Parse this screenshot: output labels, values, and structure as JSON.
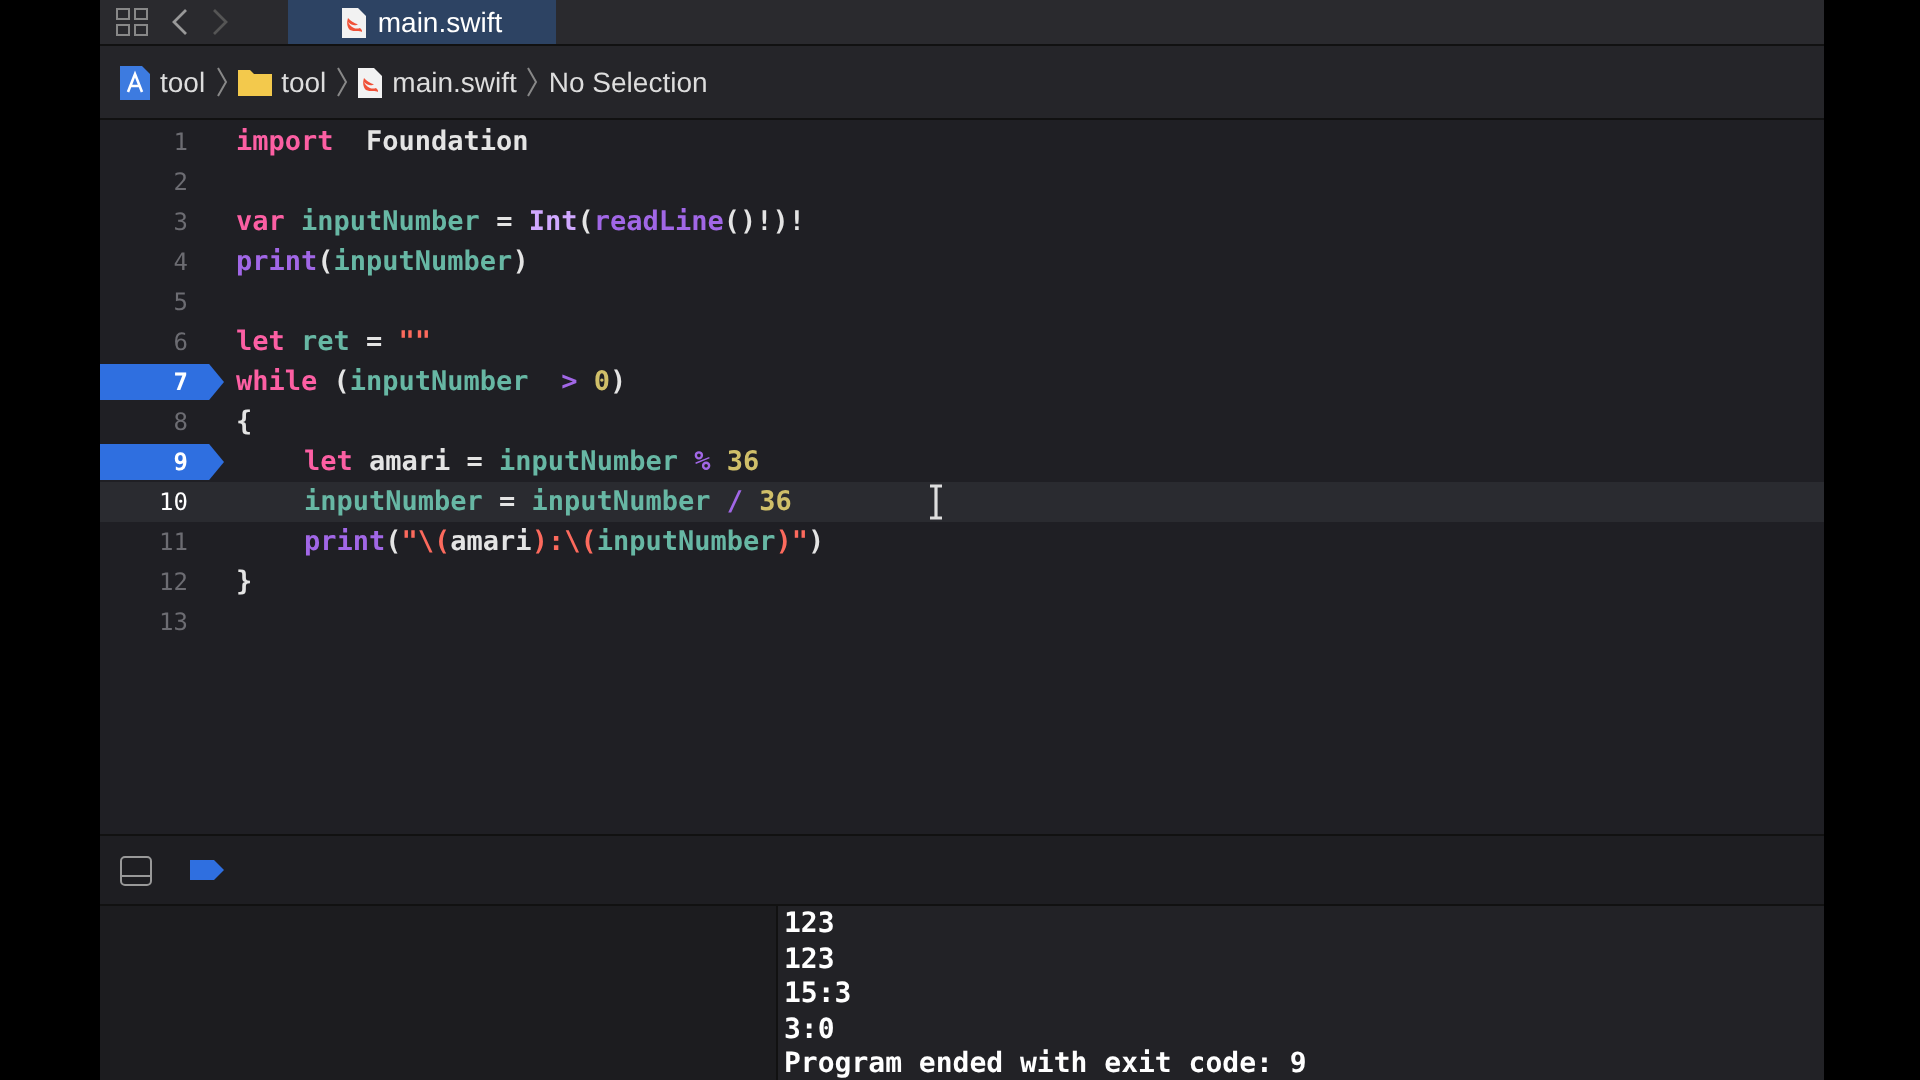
{
  "tab": {
    "title": "main.swift",
    "selected": true
  },
  "breadcrumb": [
    {
      "label": "tool",
      "kind": "project"
    },
    {
      "label": "tool",
      "kind": "folder"
    },
    {
      "label": "main.swift",
      "kind": "file"
    },
    {
      "label": "No Selection",
      "kind": "text"
    }
  ],
  "lines": [
    {
      "number": "1",
      "breakpoint": false,
      "current": false,
      "tokens": [
        {
          "text": "import",
          "kind": "keyword"
        },
        {
          "text": "  Foundation",
          "kind": "plain"
        }
      ]
    },
    {
      "number": "2",
      "breakpoint": false,
      "current": false
    },
    {
      "number": "3",
      "breakpoint": false,
      "current": false,
      "tokens": [
        {
          "text": "var",
          "kind": "keyword"
        },
        {
          "text": " inputNumber",
          "kind": "ident"
        },
        {
          "text": " = ",
          "kind": "plain"
        },
        {
          "text": "Int",
          "kind": "type"
        },
        {
          "text": "(",
          "kind": "plain"
        },
        {
          "text": "readLine",
          "kind": "func"
        },
        {
          "text": "()!)!",
          "kind": "plain"
        }
      ]
    },
    {
      "number": "4",
      "breakpoint": false,
      "current": false,
      "tokens": [
        {
          "text": "print",
          "kind": "func"
        },
        {
          "text": "(",
          "kind": "plain"
        },
        {
          "text": "inputNumber",
          "kind": "ident"
        },
        {
          "text": ")",
          "kind": "plain"
        }
      ]
    },
    {
      "number": "5",
      "breakpoint": false,
      "current": false
    },
    {
      "number": "6",
      "breakpoint": false,
      "current": false,
      "tokens": [
        {
          "text": "let",
          "kind": "keyword"
        },
        {
          "text": " ret",
          "kind": "ident"
        },
        {
          "text": " = ",
          "kind": "plain"
        },
        {
          "text": "\"\"",
          "kind": "string"
        }
      ]
    },
    {
      "number": "7",
      "breakpoint": true,
      "current": false,
      "tokens": [
        {
          "text": "while",
          "kind": "keyword"
        },
        {
          "text": " (",
          "kind": "plain"
        },
        {
          "text": "inputNumber",
          "kind": "ident"
        },
        {
          "text": "  > ",
          "kind": "func"
        },
        {
          "text": "0",
          "kind": "number"
        },
        {
          "text": ")",
          "kind": "plain"
        }
      ]
    },
    {
      "number": "8",
      "breakpoint": false,
      "current": false,
      "tokens": [
        {
          "text": "{",
          "kind": "plain"
        }
      ],
      "children": [
        {
          "number": "9",
          "breakpoint": true,
          "current": false,
          "tokens": [
            {
              "text": "let",
              "kind": "keyword"
            },
            {
              "text": " amari = ",
              "kind": "plain"
            },
            {
              "text": "inputNumber",
              "kind": "ident"
            },
            {
              "text": " % ",
              "kind": "func"
            },
            {
              "text": "36",
              "kind": "number"
            }
          ]
        },
        {
          "number": "10",
          "breakpoint": false,
          "current": true,
          "tokens": [
            {
              "text": "inputNumber",
              "kind": "ident"
            },
            {
              "text": " = ",
              "kind": "plain"
            },
            {
              "text": "inputNumber",
              "kind": "ident"
            },
            {
              "text": " / ",
              "kind": "func"
            },
            {
              "text": "36",
              "kind": "number"
            }
          ]
        },
        {
          "number": "11",
          "breakpoint": false,
          "current": false,
          "tokens": [
            {
              "text": "print",
              "kind": "func"
            },
            {
              "text": "(",
              "kind": "plain"
            },
            {
              "text": "\"\\(",
              "kind": "string"
            },
            {
              "text": "amari",
              "kind": "plain"
            },
            {
              "text": "):\\(",
              "kind": "string"
            },
            {
              "text": "inputNumber",
              "kind": "ident"
            },
            {
              "text": ")\"",
              "kind": "string"
            },
            {
              "text": ")",
              "kind": "plain"
            }
          ]
        }
      ]
    },
    {
      "number": "12",
      "breakpoint": false,
      "current": false,
      "tokens": [
        {
          "text": "}",
          "kind": "plain"
        }
      ]
    },
    {
      "number": "13",
      "breakpoint": false,
      "current": false
    }
  ],
  "console": [
    "123",
    "123",
    "15:3",
    "3:0",
    "Program ended with exit code: 9"
  ]
}
